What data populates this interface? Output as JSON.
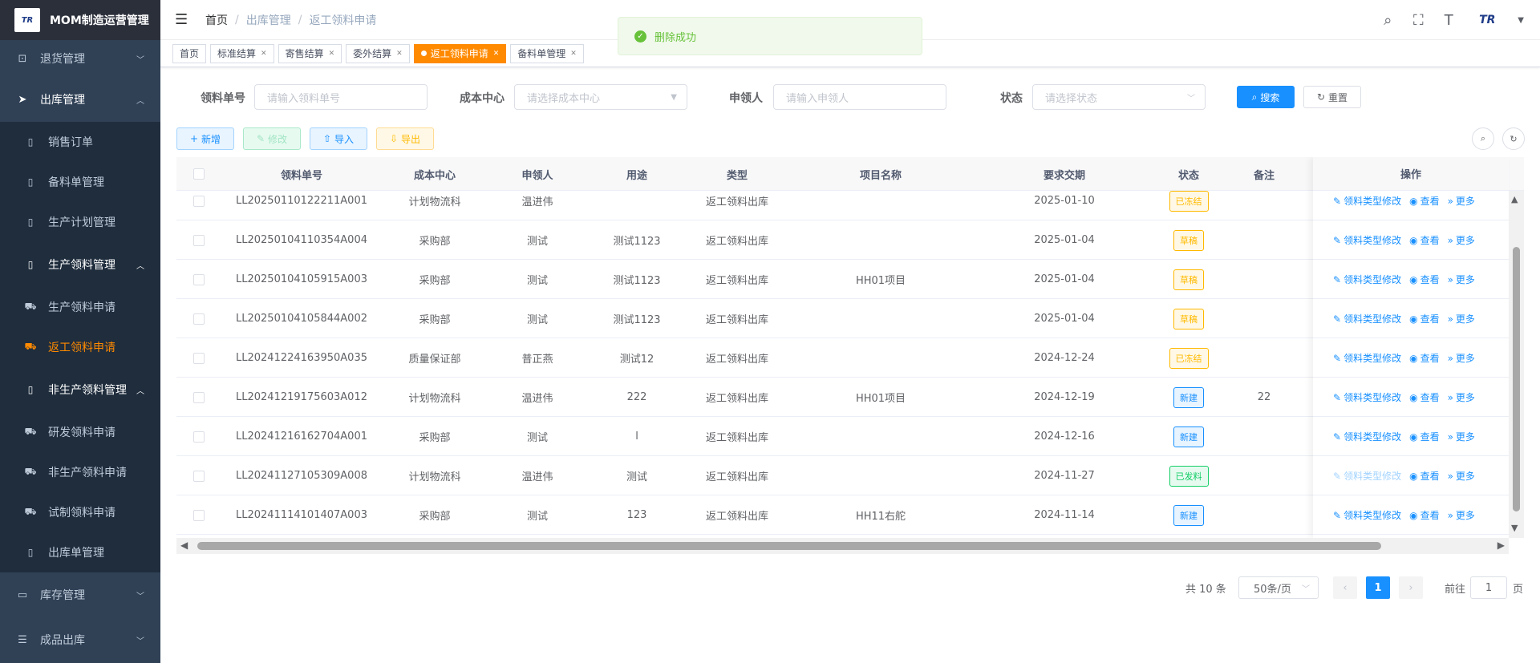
{
  "app": {
    "title": "MOM制造运营管理",
    "logo_text": "TR"
  },
  "sidebar": {
    "top1": {
      "label": "退货管理"
    },
    "group1": {
      "label": "出库管理"
    },
    "sub1": [
      {
        "label": "销售订单"
      },
      {
        "label": "备料单管理"
      },
      {
        "label": "生产计划管理"
      }
    ],
    "group_prod": {
      "label": "生产领料管理"
    },
    "sub_prod": [
      {
        "label": "生产领料申请"
      },
      {
        "label": "返工领料申请"
      }
    ],
    "group_nonprod": {
      "label": "非生产领料管理"
    },
    "sub_nonprod": [
      {
        "label": "研发领料申请"
      },
      {
        "label": "非生产领料申请"
      },
      {
        "label": "试制领料申请"
      }
    ],
    "outbound_doc": {
      "label": "出库单管理"
    },
    "top2": {
      "label": "库存管理"
    },
    "top3": {
      "label": "成品出库"
    }
  },
  "breadcrumb": [
    "首页",
    "出库管理",
    "返工领料申请"
  ],
  "tags": [
    {
      "label": "首页"
    },
    {
      "label": "标准结算"
    },
    {
      "label": "寄售结算"
    },
    {
      "label": "委外结算"
    },
    {
      "label": "返工领料申请"
    },
    {
      "label": "备料单管理"
    }
  ],
  "toast": {
    "message": "删除成功"
  },
  "search": {
    "code_label": "领料单号",
    "code_placeholder": "请输入领料单号",
    "cost_label": "成本中心",
    "cost_placeholder": "请选择成本中心",
    "applicant_label": "申领人",
    "applicant_placeholder": "请输入申领人",
    "status_label": "状态",
    "status_placeholder": "请选择状态",
    "search_btn": "搜索",
    "reset_btn": "重置"
  },
  "toolbar": {
    "add": "新增",
    "edit": "修改",
    "import": "导入",
    "export": "导出"
  },
  "table": {
    "columns": [
      "领料单号",
      "成本中心",
      "申领人",
      "用途",
      "类型",
      "项目名称",
      "要求交期",
      "状态",
      "备注",
      "操作"
    ],
    "op_labels": {
      "change_type": "领料类型修改",
      "view": "查看",
      "more": "更多"
    },
    "rows": [
      {
        "code": "LL20250110122211A001",
        "cost": "计划物流科",
        "applicant": "温进伟",
        "purpose": "",
        "type": "返工领料出库",
        "project": "",
        "due": "2025-01-10",
        "status": "已冻结",
        "status_kind": "frozen",
        "remark": "",
        "op_disabled": false
      },
      {
        "code": "LL20250104110354A004",
        "cost": "采购部",
        "applicant": "测试",
        "purpose": "测试1123",
        "type": "返工领料出库",
        "project": "",
        "due": "2025-01-04",
        "status": "草稿",
        "status_kind": "draft",
        "remark": "",
        "op_disabled": false
      },
      {
        "code": "LL20250104105915A003",
        "cost": "采购部",
        "applicant": "测试",
        "purpose": "测试1123",
        "type": "返工领料出库",
        "project": "HH01项目",
        "due": "2025-01-04",
        "status": "草稿",
        "status_kind": "draft",
        "remark": "",
        "op_disabled": false
      },
      {
        "code": "LL20250104105844A002",
        "cost": "采购部",
        "applicant": "测试",
        "purpose": "测试1123",
        "type": "返工领料出库",
        "project": "",
        "due": "2025-01-04",
        "status": "草稿",
        "status_kind": "draft",
        "remark": "",
        "op_disabled": false
      },
      {
        "code": "LL20241224163950A035",
        "cost": "质量保证部",
        "applicant": "普正燕",
        "purpose": "测试12",
        "type": "返工领料出库",
        "project": "",
        "due": "2024-12-24",
        "status": "已冻结",
        "status_kind": "frozen",
        "remark": "",
        "op_disabled": false
      },
      {
        "code": "LL20241219175603A012",
        "cost": "计划物流科",
        "applicant": "温进伟",
        "purpose": "222",
        "type": "返工领料出库",
        "project": "HH01项目",
        "due": "2024-12-19",
        "status": "新建",
        "status_kind": "new",
        "remark": "22",
        "op_disabled": false
      },
      {
        "code": "LL20241216162704A001",
        "cost": "采购部",
        "applicant": "测试",
        "purpose": "l",
        "type": "返工领料出库",
        "project": "",
        "due": "2024-12-16",
        "status": "新建",
        "status_kind": "new",
        "remark": "",
        "op_disabled": false
      },
      {
        "code": "LL20241127105309A008",
        "cost": "计划物流科",
        "applicant": "温进伟",
        "purpose": "测试",
        "type": "返工领料出库",
        "project": "",
        "due": "2024-11-27",
        "status": "已发料",
        "status_kind": "issued",
        "remark": "",
        "op_disabled": true
      },
      {
        "code": "LL20241114101407A003",
        "cost": "采购部",
        "applicant": "测试",
        "purpose": "123",
        "type": "返工领料出库",
        "project": "HH11右舵",
        "due": "2024-11-14",
        "status": "新建",
        "status_kind": "new",
        "remark": "",
        "op_disabled": false
      }
    ]
  },
  "pagination": {
    "total": "共 10 条",
    "page_size": "50条/页",
    "current": "1",
    "goto_prefix": "前往",
    "goto_value": "1",
    "goto_suffix": "页"
  }
}
